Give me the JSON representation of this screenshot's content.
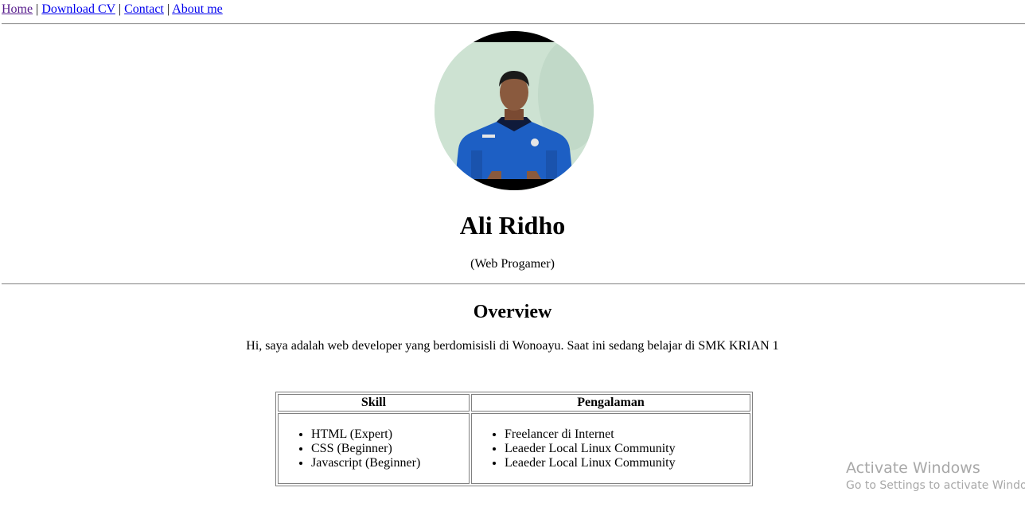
{
  "nav": {
    "items": [
      {
        "label": "Home"
      },
      {
        "label": "Download CV"
      },
      {
        "label": "Contact"
      },
      {
        "label": "About me"
      }
    ],
    "separator": "|"
  },
  "profile": {
    "name": "Ali Ridho",
    "role": "(Web Progamer)"
  },
  "overview": {
    "title": "Overview",
    "text": "Hi, saya adalah web developer yang berdomisisli di Wonoayu. Saat ini sedang belajar di SMK KRIAN 1"
  },
  "table": {
    "headers": [
      "Skill",
      "Pengalaman"
    ],
    "skills": [
      "HTML (Expert)",
      "CSS (Beginner)",
      "Javascript (Beginner)"
    ],
    "experience": [
      "Freelancer di Internet",
      "Leaeder Local Linux Community",
      "Leaeder Local Linux Community"
    ]
  },
  "watermark": {
    "line1": "Activate Windows",
    "line2": "Go to Settings to activate Windows."
  },
  "colors": {
    "link": "#0000ee",
    "visited_link": "#551a8b",
    "shirt": "#1d5fc4",
    "wall": "#c9dfcf"
  }
}
